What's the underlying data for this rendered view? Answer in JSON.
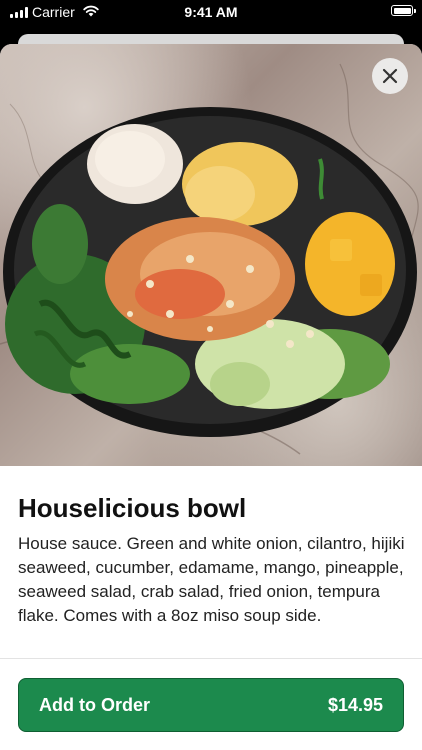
{
  "status_bar": {
    "carrier": "Carrier",
    "time": "9:41 AM",
    "icons": [
      "signal-icon",
      "wifi-icon",
      "battery-icon"
    ]
  },
  "item": {
    "title": "Houselicious bowl",
    "description": "House sauce. Green and white onion, cilantro, hijiki seaweed, cucumber, edamame, mango, pineapple, seaweed salad, crab salad, fried onion, tempura flake. Comes with a 8oz miso soup side.",
    "image_icon": "poke-bowl-photo"
  },
  "close_icon": "close-icon",
  "order_button": {
    "label": "Add to Order",
    "price": "$14.95"
  },
  "colors": {
    "accent": "#1c8a4d",
    "accent_border": "#0f5f32"
  }
}
